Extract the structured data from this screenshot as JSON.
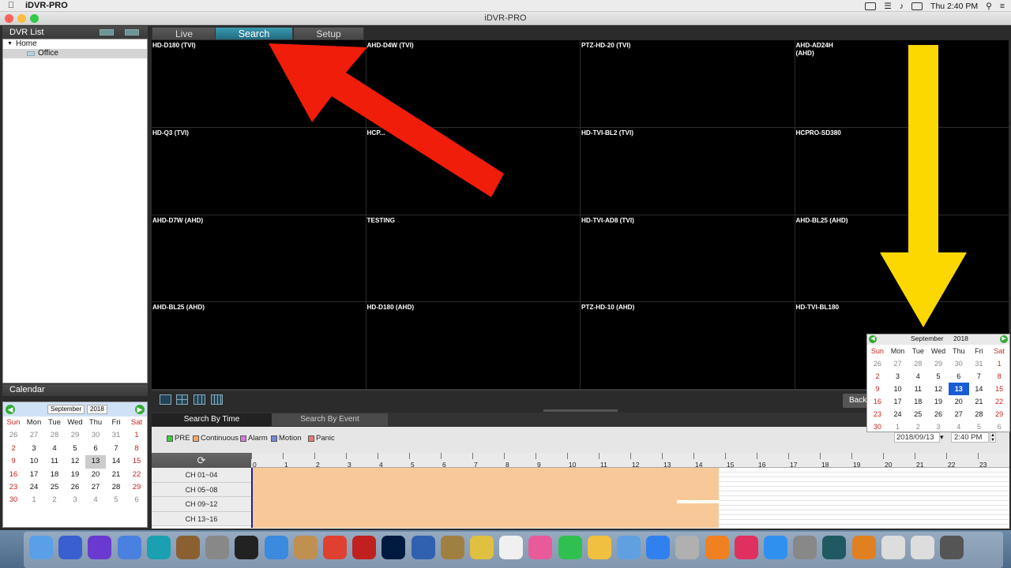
{
  "menubar": {
    "app_name": "iDVR-PRO",
    "clock": "Thu 2:40 PM"
  },
  "window": {
    "title": "iDVR-PRO"
  },
  "dvr_list": {
    "title": "DVR List",
    "tree": [
      {
        "label": "Home"
      },
      {
        "label": "Office"
      }
    ]
  },
  "calendar_panel": {
    "title": "Calendar",
    "month": "September",
    "year": "2018",
    "day_headers": [
      "Sun",
      "Mon",
      "Tue",
      "Wed",
      "Thu",
      "Fri",
      "Sat"
    ],
    "days": [
      "26",
      "27",
      "28",
      "29",
      "30",
      "31",
      "1",
      "2",
      "3",
      "4",
      "5",
      "6",
      "7",
      "8",
      "9",
      "10",
      "11",
      "12",
      "13",
      "14",
      "15",
      "16",
      "17",
      "18",
      "19",
      "20",
      "21",
      "22",
      "23",
      "24",
      "25",
      "26",
      "27",
      "28",
      "29",
      "30",
      "1",
      "2",
      "3",
      "4",
      "5",
      "6"
    ],
    "highlighted_day": "13"
  },
  "tabs": [
    {
      "label": "Live"
    },
    {
      "label": "Search"
    },
    {
      "label": "Setup"
    }
  ],
  "cameras": [
    {
      "label": "HD-D180 (TVI)"
    },
    {
      "label": "AHD-D4W (TVI)"
    },
    {
      "label": "PTZ-HD-20 (TVI)"
    },
    {
      "label": "AHD-AD24H\n(AHD)"
    },
    {
      "label": "HD-Q3 (TVI)"
    },
    {
      "label": "HCP..."
    },
    {
      "label": "HD-TVI-BL2 (TVI)"
    },
    {
      "label": "HCPRO-SD380"
    },
    {
      "label": "AHD-D7W (AHD)"
    },
    {
      "label": "TESTING"
    },
    {
      "label": "HD-TVI-AD8 (TVI)"
    },
    {
      "label": "AHD-BL25 (AHD)"
    },
    {
      "label": "AHD-BL25 (AHD)"
    },
    {
      "label": "HD-D180 (AHD)"
    },
    {
      "label": "PTZ-HD-10 (AHD)"
    },
    {
      "label": "HD-TVI-BL180"
    }
  ],
  "toolbar": {
    "back_label": "Back"
  },
  "search_tabs": [
    {
      "label": "Search By Time"
    },
    {
      "label": "Search By Event"
    }
  ],
  "legend": [
    {
      "label": "PRE",
      "color": "#3bd13b"
    },
    {
      "label": "Continuous",
      "color": "#f5a86a"
    },
    {
      "label": "Alarm",
      "color": "#d67adb"
    },
    {
      "label": "Motion",
      "color": "#7a86d6"
    },
    {
      "label": "Panic",
      "color": "#e87a7a"
    }
  ],
  "search": {
    "date": "2018/09/13",
    "time": "2:40 PM"
  },
  "timeline": {
    "hours": [
      "0",
      "1",
      "2",
      "3",
      "4",
      "5",
      "6",
      "7",
      "8",
      "9",
      "10",
      "11",
      "12",
      "13",
      "14",
      "15",
      "16",
      "17",
      "18",
      "19",
      "20",
      "21",
      "22",
      "23"
    ],
    "channels": [
      {
        "label": "CH 01~04"
      },
      {
        "label": "CH 05~08"
      },
      {
        "label": "CH 09~12"
      },
      {
        "label": "CH 13~16"
      }
    ]
  },
  "popup_calendar": {
    "month": "September",
    "year": "2018",
    "day_headers": [
      "Sun",
      "Mon",
      "Tue",
      "Wed",
      "Thu",
      "Fri",
      "Sat"
    ],
    "days": [
      "26",
      "27",
      "28",
      "29",
      "30",
      "31",
      "1",
      "2",
      "3",
      "4",
      "5",
      "6",
      "7",
      "8",
      "9",
      "10",
      "11",
      "12",
      "13",
      "14",
      "15",
      "16",
      "17",
      "18",
      "19",
      "20",
      "21",
      "22",
      "23",
      "24",
      "25",
      "26",
      "27",
      "28",
      "29",
      "30",
      "1",
      "2",
      "3",
      "4",
      "5",
      "6"
    ],
    "selected_day": "13"
  }
}
